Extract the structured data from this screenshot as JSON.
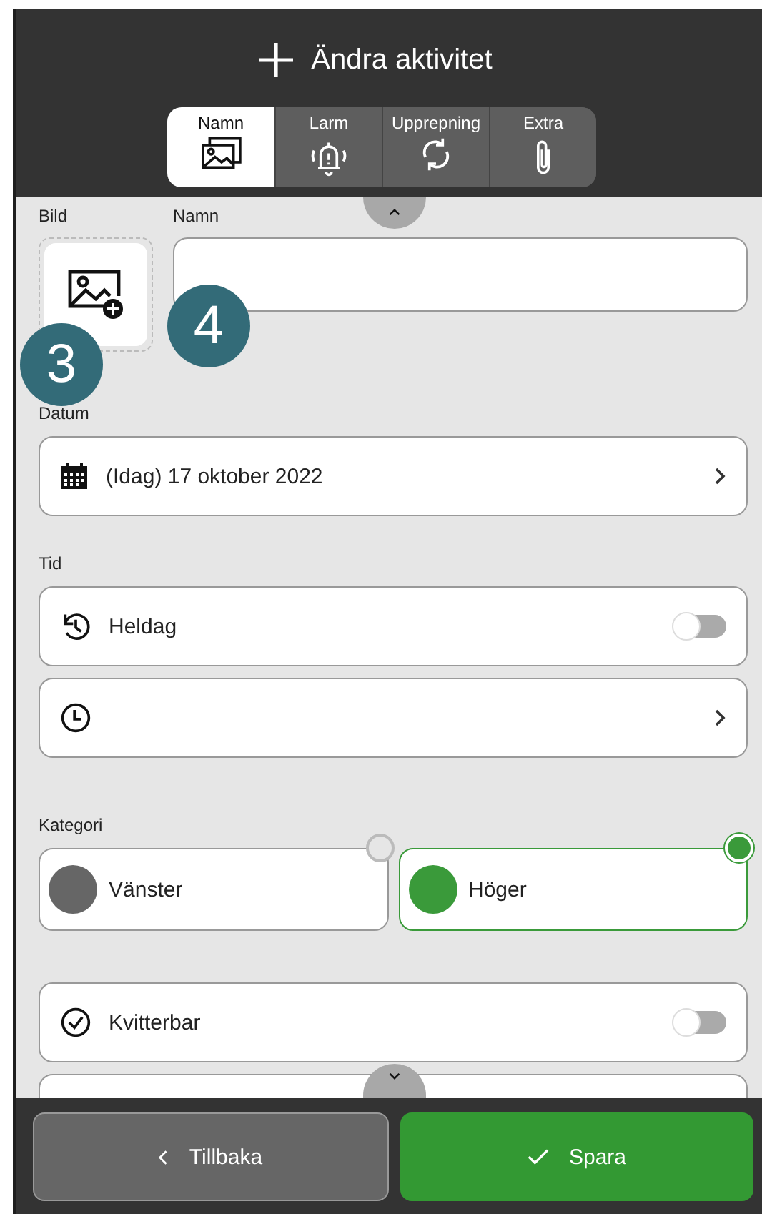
{
  "header": {
    "title": "Ändra aktivitet"
  },
  "tabs": [
    {
      "label": "Namn",
      "selected": true
    },
    {
      "label": "Larm",
      "selected": false
    },
    {
      "label": "Upprepning",
      "selected": false
    },
    {
      "label": "Extra",
      "selected": false
    }
  ],
  "image": {
    "label": "Bild"
  },
  "name": {
    "label": "Namn"
  },
  "markers": [
    {
      "label": "3"
    },
    {
      "label": "4"
    }
  ],
  "date": {
    "label": "Datum",
    "value": "(Idag) 17 oktober 2022"
  },
  "time": {
    "label": "Tid",
    "all_day": {
      "label": "Heldag",
      "on": false
    }
  },
  "category": {
    "label": "Kategori",
    "options": [
      {
        "label": "Vänster",
        "color": "#666666",
        "selected": false
      },
      {
        "label": "Höger",
        "color": "#3a9a3a",
        "selected": true
      }
    ]
  },
  "confirm": {
    "label": "Kvitterbar",
    "on": false
  },
  "footer": {
    "back": "Tillbaka",
    "save": "Spara"
  }
}
